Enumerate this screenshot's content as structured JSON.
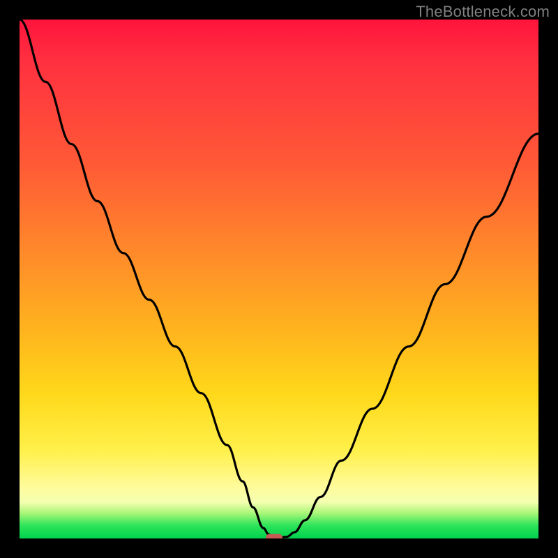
{
  "watermark": "TheBottleneck.com",
  "chart_data": {
    "type": "line",
    "title": "",
    "xlabel": "",
    "ylabel": "",
    "xlim": [
      0,
      100
    ],
    "ylim": [
      0,
      100
    ],
    "grid": false,
    "legend": false,
    "series": [
      {
        "name": "bottleneck-curve",
        "color": "#000000",
        "x": [
          0,
          5,
          10,
          15,
          20,
          25,
          30,
          35,
          40,
          43,
          45,
          47,
          48,
          49,
          50,
          51.5,
          53,
          55,
          58,
          62,
          68,
          75,
          82,
          90,
          100
        ],
        "values": [
          100,
          88,
          76,
          65,
          55,
          46,
          37,
          28,
          18,
          11,
          6,
          2,
          0.8,
          0.3,
          0.2,
          0.3,
          1.2,
          3.5,
          8,
          15,
          25,
          37,
          49,
          62,
          78
        ]
      }
    ],
    "marker": {
      "x": 49,
      "y": 0.2,
      "color": "#c65a55"
    },
    "background_gradient": {
      "top": "#ff143c",
      "mid_upper": "#ff8a2a",
      "mid": "#ffd81a",
      "mid_lower": "#fffb9a",
      "bottom": "#00d24e"
    }
  }
}
